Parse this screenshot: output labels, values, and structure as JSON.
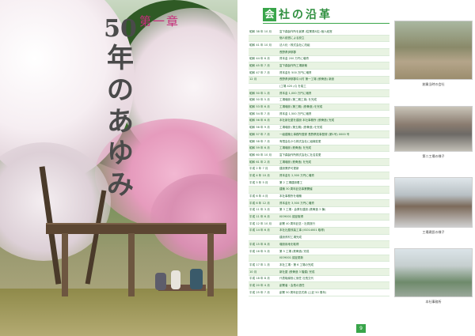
{
  "left_page": {
    "chapter_label": "第一章",
    "title_number": "50",
    "title_chars": [
      "年",
      "の",
      "あ",
      "ゆ",
      "み"
    ]
  },
  "right_page": {
    "heading_badge": "会",
    "heading_rest": "社の沿革",
    "page_number": "9",
    "timeline": [
      {
        "date": "昭和 38 年 10 月",
        "desc": "富下森製作所を創業 (従業員8名) 個人経営"
      },
      {
        "date": "",
        "desc": "個人経営による設立"
      },
      {
        "date": "昭和 41 年 10 月",
        "desc": "法人化・株式会社に改組"
      },
      {
        "date": "",
        "desc": "長野県伊那郡"
      },
      {
        "date": "昭和 44 年 6 月",
        "desc": "資本金 200 万円に増資"
      },
      {
        "date": "昭和 45 年 7 月",
        "desc": "富下森製作所工場新築"
      },
      {
        "date": "昭和 47 年 7 月",
        "desc": "資本金を 500 万円に増資"
      },
      {
        "date": "12 月",
        "desc": "長野県伊那郡中川村 第一工場 (鉄骨造) 新設"
      },
      {
        "date": "",
        "desc": "(工場 420 ㎡) を竣工"
      },
      {
        "date": "昭和 50 年 1 月",
        "desc": "資本金 1,000 万円に増資"
      },
      {
        "date": "昭和 50 年 5 月",
        "desc": "工場増設 (第二期工事) を完成"
      },
      {
        "date": "昭和 53 年 6 月",
        "desc": "工場増設 (第三期) (鉄骨造) を完成"
      },
      {
        "date": "昭和 54 年 7 月",
        "desc": "資本金 1,500 万円に増資"
      },
      {
        "date": "昭和 56 年 6 月",
        "desc": "本社新社屋を建設 本社事務所 (鉄骨造) 完成"
      },
      {
        "date": "昭和 56 年 9 月",
        "desc": "工場増設 (第五期) (鉄骨造) を完成"
      },
      {
        "date": "昭和 57 年 7 月",
        "desc": "一級建築士事務所登録 長野県知事登録 (第1号) 0000 号"
      },
      {
        "date": "昭和 58 年 7 月",
        "desc": "有限会社から株式会社に組織変更"
      },
      {
        "date": "昭和 59 年 6 月",
        "desc": "工場増設 (鉄骨造) を完成"
      },
      {
        "date": "昭和 60 年 10 月",
        "desc": "富下森製作所株式会社に社名変更"
      },
      {
        "date": "昭和 61 年 2 月",
        "desc": "工場増設 (鉄骨造) を完成"
      },
      {
        "date": "平成 2 年 7 月",
        "desc": "建設業許可更新"
      },
      {
        "date": "平成 4 年 10 月",
        "desc": "資本金を 2,500 万円に増資"
      },
      {
        "date": "平成 5 年 5 月",
        "desc": "第 2 工場建設着工"
      },
      {
        "date": "",
        "desc": "建築 30 周年記念事業開催"
      },
      {
        "date": "平成 6 年 4 月",
        "desc": "本社事務所を増築"
      },
      {
        "date": "平成 6 年 12 月",
        "desc": "資本金を 3,500 万円に増資"
      },
      {
        "date": "平成 11 年 3 月",
        "desc": "第 3 工場・倉庫を建設 (鉄骨造 3 棟)"
      },
      {
        "date": "平成 11 年 6 月",
        "desc": "ISO9001 認証取得"
      },
      {
        "date": "平成 12 年 10 月",
        "desc": "創業 40 周年記念・社員旅行"
      },
      {
        "date": "平成 14 年 6 月",
        "desc": "本社社屋改装工事 (ISO14001 取得)"
      },
      {
        "date": "",
        "desc": "建設資材工場完成"
      },
      {
        "date": "平成 15 年 8 月",
        "desc": "増設用地を取得"
      },
      {
        "date": "平成 16 年 5 月",
        "desc": "第 5 工場 (鉄骨造) 完成"
      },
      {
        "date": "",
        "desc": "ISO9001 認証更新"
      },
      {
        "date": "平成 17 年 1 月",
        "desc": "本社工場・第 6 工場の完成"
      },
      {
        "date": "10 月",
        "desc": "新社屋 (鉄骨造 3 階建) 完成"
      },
      {
        "date": "平成 18 年 8 月",
        "desc": "代表取締役に就任 社長交代"
      },
      {
        "date": "平成 20 年 4 月",
        "desc": "創業者・会長の退任"
      },
      {
        "date": "平成 25 年 7 月",
        "desc": "創業 50 周年記念式典 (上記 50 周年)"
      }
    ],
    "photos": [
      {
        "caption": "創業当時の会社"
      },
      {
        "caption": "第二工場の様子"
      },
      {
        "caption": "工場建設の様子"
      },
      {
        "caption": "本社事務所"
      }
    ]
  }
}
